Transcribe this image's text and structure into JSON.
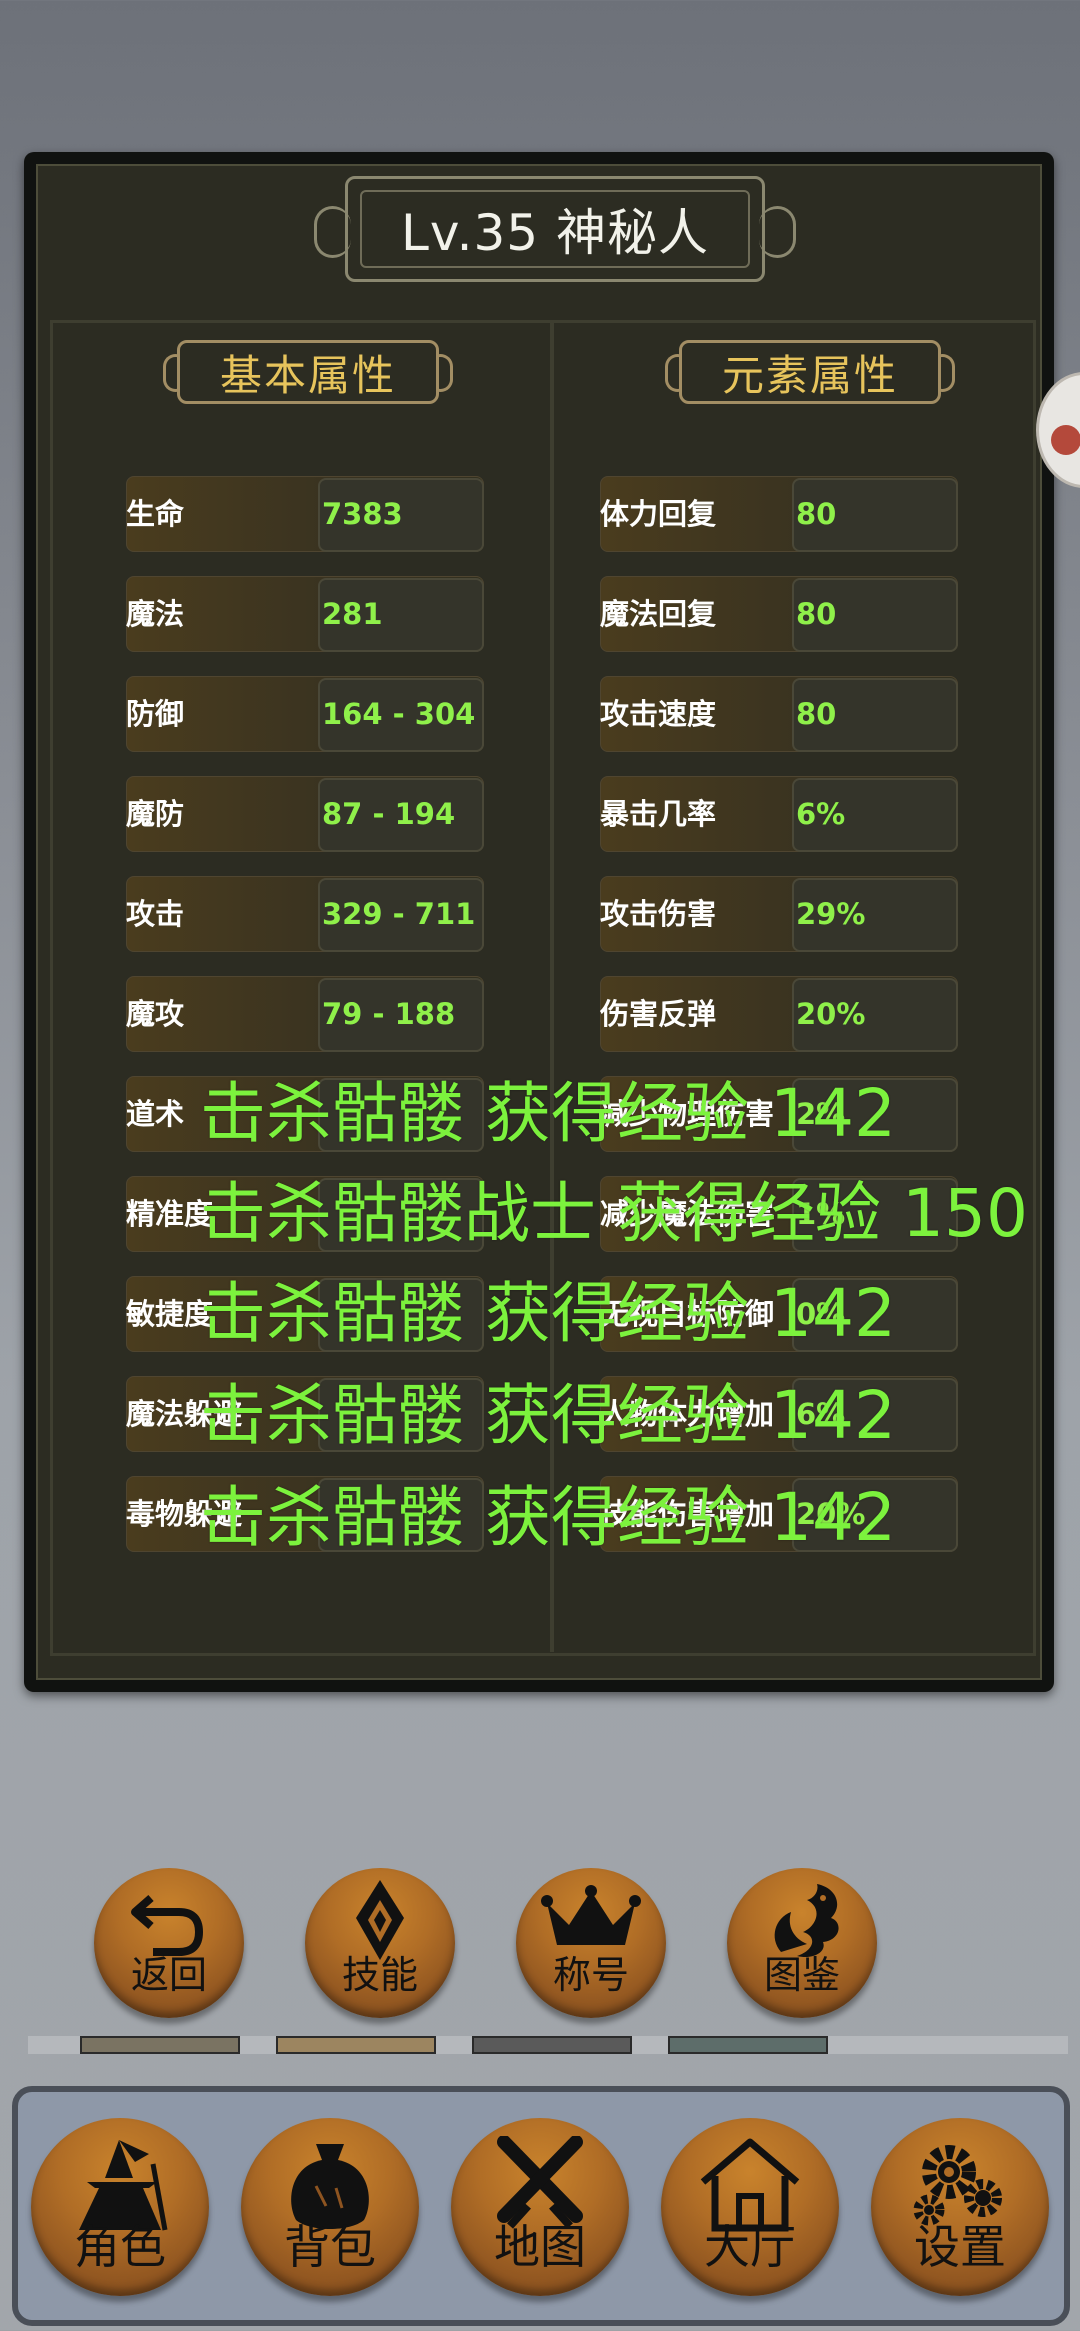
{
  "character": {
    "title": "Lv.35 神秘人"
  },
  "sections": {
    "basic": "基本属性",
    "element": "元素属性"
  },
  "basic_stats": [
    {
      "label": "生命",
      "value": "7383"
    },
    {
      "label": "魔法",
      "value": "281"
    },
    {
      "label": "防御",
      "value": "164 - 304"
    },
    {
      "label": "魔防",
      "value": "87 - 194"
    },
    {
      "label": "攻击",
      "value": "329 - 711"
    },
    {
      "label": "魔攻",
      "value": "79 - 188"
    },
    {
      "label": "道术",
      "value": ""
    },
    {
      "label": "精准度",
      "value": ""
    },
    {
      "label": "敏捷度",
      "value": ""
    },
    {
      "label": "魔法躲避",
      "value": ""
    },
    {
      "label": "毒物躲避",
      "value": ""
    }
  ],
  "element_stats": [
    {
      "label": "体力回复",
      "value": "80"
    },
    {
      "label": "魔法回复",
      "value": "80"
    },
    {
      "label": "攻击速度",
      "value": "80"
    },
    {
      "label": "暴击几率",
      "value": "6%"
    },
    {
      "label": "攻击伤害",
      "value": "29%"
    },
    {
      "label": "伤害反弹",
      "value": "20%"
    },
    {
      "label": "减少物理伤害",
      "value": "2%"
    },
    {
      "label": "减少魔法伤害",
      "value": "1%"
    },
    {
      "label": "无视目标防御",
      "value": "0%"
    },
    {
      "label": "人物体力增加",
      "value": "6%"
    },
    {
      "label": "技能伤害增加",
      "value": "20%"
    }
  ],
  "exp_messages": [
    "击杀骷髅 获得经验 142",
    "击杀骷髅战士 获得经验 150",
    "击杀骷髅 获得经验 142",
    "击杀骷髅 获得经验 142",
    "击杀骷髅 获得经验 142"
  ],
  "action_buttons": [
    {
      "label": "返回",
      "icon": "return-arrow-icon"
    },
    {
      "label": "技能",
      "icon": "skill-emblem-icon"
    },
    {
      "label": "称号",
      "icon": "crown-icon"
    },
    {
      "label": "图鉴",
      "icon": "dragon-icon"
    }
  ],
  "nav_buttons": [
    {
      "label": "角色",
      "icon": "wizard-icon"
    },
    {
      "label": "背包",
      "icon": "bag-icon"
    },
    {
      "label": "地图",
      "icon": "crossed-swords-icon"
    },
    {
      "label": "大厅",
      "icon": "house-icon"
    },
    {
      "label": "设置",
      "icon": "gears-icon"
    }
  ],
  "colors": {
    "stat_value": "#8ff04a",
    "exp_message": "#7cf23d",
    "section_title": "#e7c45c",
    "button_orange": "#b06d26"
  }
}
